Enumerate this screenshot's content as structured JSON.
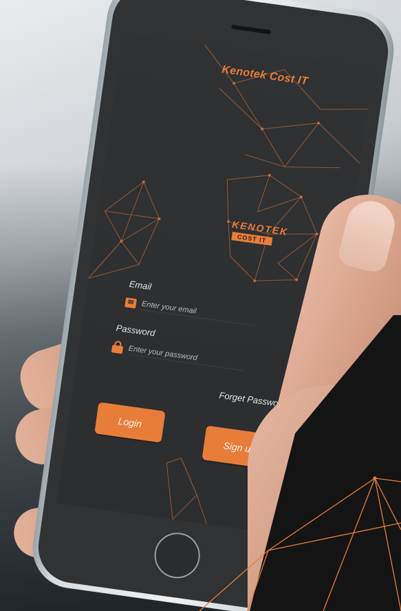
{
  "app": {
    "title": "Kenotek Cost IT",
    "logo_word": "KENOTEK",
    "logo_sub": "COST IT"
  },
  "login_form": {
    "email_label": "Email",
    "email_placeholder": "Enter your email",
    "email_icon": "envelope-icon",
    "password_label": "Password",
    "password_placeholder": "Enter your password",
    "password_icon": "lock-icon",
    "forgot_password": "Forget Password",
    "login_button": "Login",
    "signup_button": "Sign up"
  },
  "colors": {
    "accent": "#e87d3a",
    "screen_bg": "#2f3133",
    "text": "#e2e4e6"
  }
}
